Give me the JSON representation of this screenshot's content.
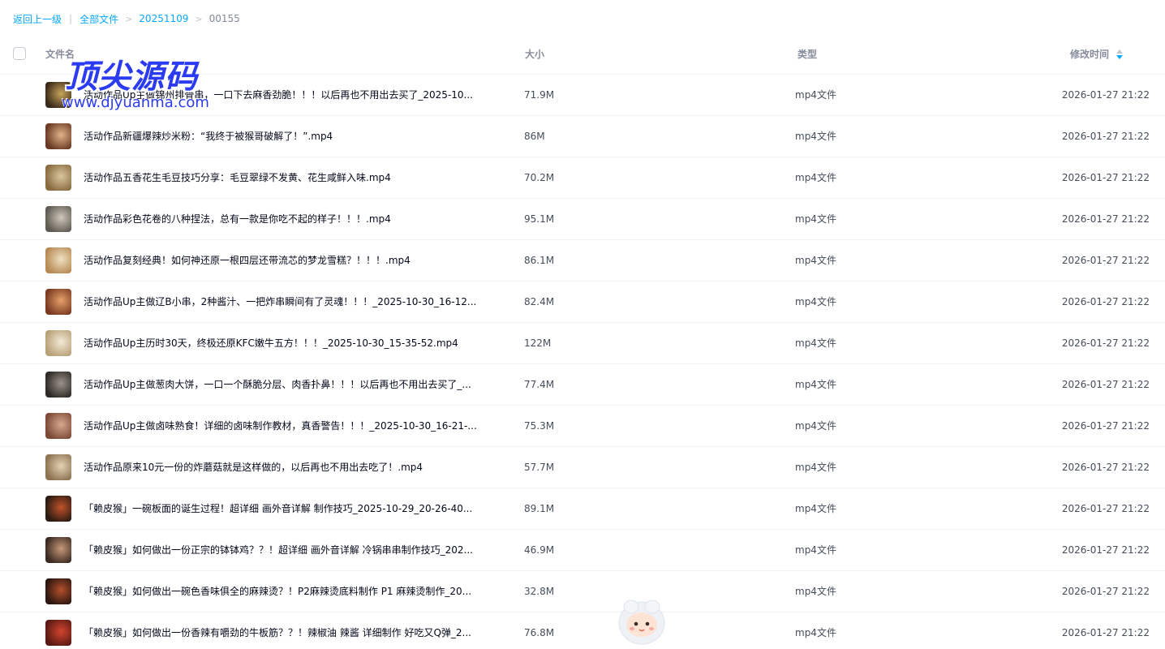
{
  "breadcrumb": {
    "back": "返回上一级",
    "divider": "|",
    "separator": ">",
    "items": [
      "全部文件",
      "20251109"
    ],
    "current": "00155"
  },
  "columns": {
    "name": "文件名",
    "size": "大小",
    "type": "类型",
    "modified": "修改时间"
  },
  "sort": {
    "column": "修改时间",
    "direction": "descending"
  },
  "files": [
    {
      "name": "活动作品Up主做锦州排骨串，一口下去麻香劲脆！！！以后再也不用出去买了_2025-10...",
      "size": "71.9M",
      "type": "mp4文件",
      "modified": "2026-01-27 21:22",
      "thumb_colors": [
        "#3a2a1a",
        "#c9a55a"
      ]
    },
    {
      "name": "活动作品新疆爆辣炒米粉：“我终于被猴哥破解了！”.mp4",
      "size": "86M",
      "type": "mp4文件",
      "modified": "2026-01-27 21:22",
      "thumb_colors": [
        "#6b3a24",
        "#e1b38a"
      ]
    },
    {
      "name": "活动作品五香花生毛豆技巧分享：毛豆翠绿不发黄、花生咸鲜入味.mp4",
      "size": "70.2M",
      "type": "mp4文件",
      "modified": "2026-01-27 21:22",
      "thumb_colors": [
        "#8a6b3f",
        "#d9c7a0"
      ]
    },
    {
      "name": "活动作品彩色花卷的八种捏法，总有一款是你吃不起的样子！！！.mp4",
      "size": "95.1M",
      "type": "mp4文件",
      "modified": "2026-01-27 21:22",
      "thumb_colors": [
        "#5f5a52",
        "#cfc8bb"
      ]
    },
    {
      "name": "活动作品复刻经典！如何神还原一根四层还带流芯的梦龙雪糕？！！！.mp4",
      "size": "86.1M",
      "type": "mp4文件",
      "modified": "2026-01-27 21:22",
      "thumb_colors": [
        "#b88a54",
        "#efe1c2"
      ]
    },
    {
      "name": "活动作品Up主做辽B小串，2种酱汁、一把炸串瞬间有了灵魂！！！_2025-10-30_16-12...",
      "size": "82.4M",
      "type": "mp4文件",
      "modified": "2026-01-27 21:22",
      "thumb_colors": [
        "#7a3b22",
        "#e6a06a"
      ]
    },
    {
      "name": "活动作品Up主历时30天，终极还原KFC嫩牛五方！！！_2025-10-30_15-35-52.mp4",
      "size": "122M",
      "type": "mp4文件",
      "modified": "2026-01-27 21:22",
      "thumb_colors": [
        "#b9a17a",
        "#f3ead6"
      ]
    },
    {
      "name": "活动作品Up主做葱肉大饼，一口一个酥脆分层、肉香扑鼻！！！以后再也不用出去买了_...",
      "size": "77.4M",
      "type": "mp4文件",
      "modified": "2026-01-27 21:22",
      "thumb_colors": [
        "#2e2a26",
        "#9b928a"
      ]
    },
    {
      "name": "活动作品Up主做卤味熟食！详细的卤味制作教材，真香警告！！！_2025-10-30_16-21-...",
      "size": "75.3M",
      "type": "mp4文件",
      "modified": "2026-01-27 21:22",
      "thumb_colors": [
        "#7b4a36",
        "#d8a88e"
      ]
    },
    {
      "name": "活动作品原来10元一份的炸蘑菇就是这样做的，以后再也不用出去吃了！.mp4",
      "size": "57.7M",
      "type": "mp4文件",
      "modified": "2026-01-27 21:22",
      "thumb_colors": [
        "#8d7352",
        "#e4d3b4"
      ]
    },
    {
      "name": "「赖皮猴」一碗板面的诞生过程！超详细 画外音详解 制作技巧_2025-10-29_20-26-40...",
      "size": "89.1M",
      "type": "mp4文件",
      "modified": "2026-01-27 21:22",
      "thumb_colors": [
        "#2a1a12",
        "#c2532a"
      ]
    },
    {
      "name": "「赖皮猴」如何做出一份正宗的钵钵鸡？？！超详细 画外音详解 冷锅串串制作技巧_202...",
      "size": "46.9M",
      "type": "mp4文件",
      "modified": "2026-01-27 21:22",
      "thumb_colors": [
        "#3b2a22",
        "#c89a7a"
      ]
    },
    {
      "name": "「赖皮猴」如何做出一碗色香味俱全的麻辣烫？！P2麻辣烫底料制作 P1 麻辣烫制作_20...",
      "size": "32.8M",
      "type": "mp4文件",
      "modified": "2026-01-27 21:22",
      "thumb_colors": [
        "#2b1610",
        "#b5502c"
      ]
    },
    {
      "name": "「赖皮猴」如何做出一份香辣有嚼劲的牛板筋？？！辣椒油 辣酱 详细制作 好吃又Q弹_2...",
      "size": "76.8M",
      "type": "mp4文件",
      "modified": "2026-01-27 21:22",
      "thumb_colors": [
        "#5a1a14",
        "#d2442e"
      ]
    }
  ],
  "watermark": {
    "title": "顶尖源码",
    "url": "www.djyuanma.com"
  },
  "colors": {
    "accent": "#06a7ff",
    "text": "#03081a",
    "muted": "#878c9c",
    "watermark": "#2b3bf2"
  }
}
